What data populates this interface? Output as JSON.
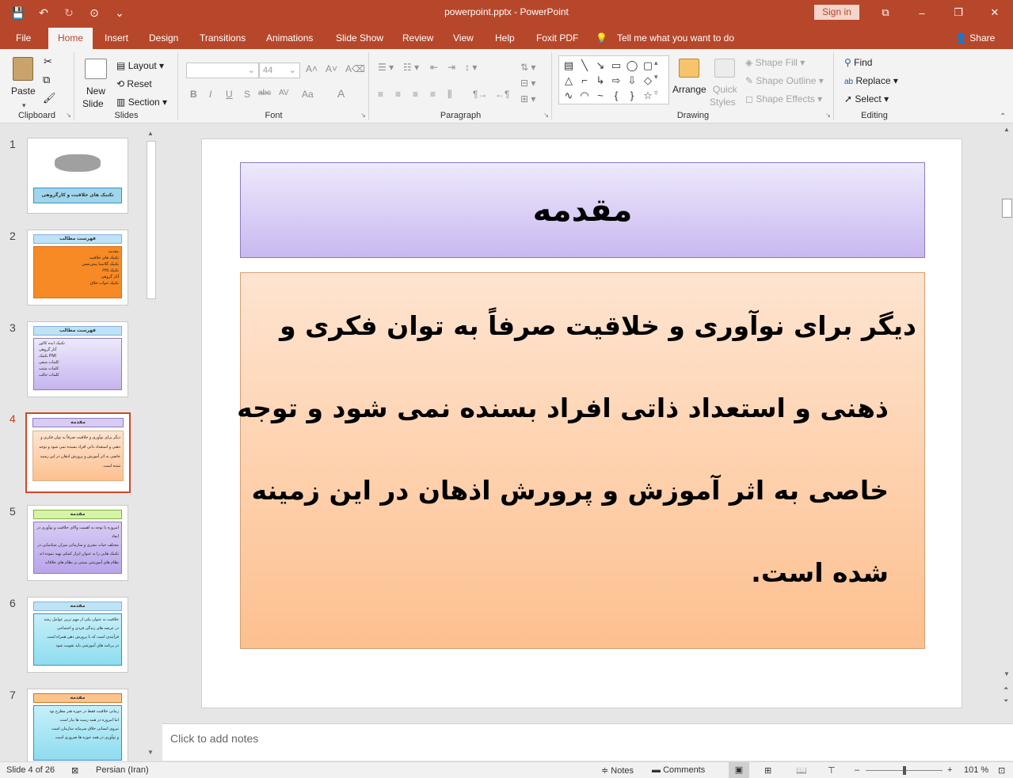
{
  "titlebar": {
    "title": "powerpoint.pptx  -  PowerPoint",
    "sign_in": "Sign in",
    "qat": {
      "save": "💾",
      "undo": "↶",
      "redo": "↻",
      "present": "⊙",
      "more": "⌄"
    },
    "window": {
      "ribbon_display": "⧉",
      "minimize": "–",
      "restore": "❐",
      "close": "✕"
    }
  },
  "tabs": {
    "file": "File",
    "home": "Home",
    "insert": "Insert",
    "design": "Design",
    "transitions": "Transitions",
    "animations": "Animations",
    "slideshow": "Slide Show",
    "review": "Review",
    "view": "View",
    "help": "Help",
    "foxit": "Foxit PDF",
    "tellme": "Tell me what you want to do",
    "share": "Share"
  },
  "ribbon": {
    "clipboard": {
      "label": "Clipboard",
      "paste": "Paste"
    },
    "slides": {
      "label": "Slides",
      "new_slide_1": "New",
      "new_slide_2": "Slide",
      "layout": "Layout",
      "reset": "Reset",
      "section": "Section"
    },
    "font": {
      "label": "Font",
      "size": "44",
      "bold": "B",
      "italic": "I",
      "underline": "U",
      "shadow": "S",
      "strike": "abc",
      "spacing": "AV",
      "case": "Aa",
      "color": "A"
    },
    "paragraph": {
      "label": "Paragraph"
    },
    "drawing": {
      "label": "Drawing",
      "arrange": "Arrange",
      "quick_styles_1": "Quick",
      "quick_styles_2": "Styles",
      "shape_fill": "Shape Fill",
      "shape_outline": "Shape Outline",
      "shape_effects": "Shape Effects"
    },
    "editing": {
      "label": "Editing",
      "find": "Find",
      "replace": "Replace",
      "select": "Select"
    }
  },
  "thumbnails": [
    {
      "num": "1",
      "title": "تکنیک های خلاقیت و کارگروهی"
    },
    {
      "num": "2",
      "title": "فهرست مطالب",
      "lines": [
        "مقدمه",
        "تکنیک های خلاقیت",
        "تکنیک گلاسیا پیش‌نفس",
        "تکنیک ۶۳۵",
        "آثار گروهی",
        "تکنیک خواب خلاق"
      ]
    },
    {
      "num": "3",
      "title": "فهرست مطالب",
      "lines": [
        "تکنیک ایده کالور",
        "آثار گروهی",
        "تکنیک PMI",
        "کلمات منفی",
        "کلمات مثبت",
        "کلمات جالب"
      ]
    },
    {
      "num": "4",
      "title": "مقدمه",
      "lines": [
        "دیگر برای نوآوری و خلاقیت صرفاً به توان فکری و",
        "ذهنی و استعداد ذاتی افراد بسنده نمی شود و توجه",
        "خاصی به اثر آموزش و پرورش اذهان در این زمینه",
        "شده است."
      ]
    },
    {
      "num": "5",
      "title": "مقدمه",
      "lines": [
        "امروزه با توجه به اهمیت والای خلاقیت و نوآوری در ابعاد",
        "مختلف حیات بشری و سازمانی میزان شناسایی در",
        "تکنیک هایی را به عنوان ابزار کمکی تهیه نموده اند",
        "نظام های آموزشی مبتنی بر نظام های خلاقانه"
      ]
    },
    {
      "num": "6",
      "title": "مقدمه",
      "lines": [
        "خلاقیت به عنوان یکی از مهم ترین عوامل رشد",
        "در عرصه های زندگی فردی و اجتماعی",
        "فرآیندی است که با پرورش ذهن همراه است",
        "در برنامه های آموزشی باید تقویت شود"
      ]
    },
    {
      "num": "7",
      "title": "مقدمه",
      "lines": [
        "زمانی خلاقیت فقط در حوزه هنر مطرح بود",
        "اما امروزه در همه زمینه ها نیاز است",
        "نیروی انسانی خلاق سرمایه سازمان است",
        "و نوآوری در همه حوزه ها ضروری است"
      ]
    }
  ],
  "slide": {
    "title": "مقدمه",
    "body": [
      "دیگر برای نوآوری و خلاقیت صرفاً به توان فکری و",
      "ذهنی و استعداد ذاتی افراد بسنده نمی شود و توجه",
      "خاصی به اثر آموزش و پرورش اذهان در این زمینه",
      "شده است."
    ]
  },
  "notes": {
    "placeholder": "Click to add notes"
  },
  "status": {
    "slide": "Slide 4 of 26",
    "language": "Persian (Iran)",
    "notes": "Notes",
    "comments": "Comments",
    "zoom": "101 %"
  },
  "colors": {
    "accent": "#b7472a",
    "title_fill": "#d9ccf4",
    "body_fill": "#fdcfa8"
  }
}
